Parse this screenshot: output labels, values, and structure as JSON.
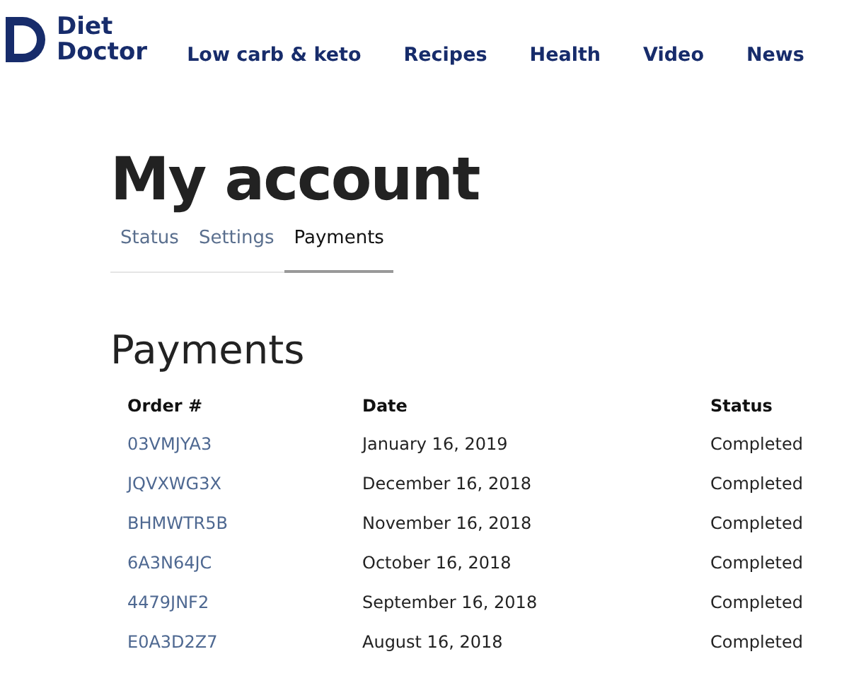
{
  "brand": {
    "line_1": "Diet",
    "line_2": "Doctor"
  },
  "nav": [
    "Low carb & keto",
    "Recipes",
    "Health",
    "Video",
    "News"
  ],
  "page_title": "My account",
  "tabs": [
    {
      "label": "Status",
      "selected": false
    },
    {
      "label": "Settings",
      "selected": false
    },
    {
      "label": "Payments",
      "selected": true
    }
  ],
  "section_title": "Payments",
  "table": {
    "columns": [
      "Order #",
      "Date",
      "Status"
    ],
    "rows": [
      [
        "03VMJYA3",
        "January 16, 2019",
        "Completed"
      ],
      [
        "JQVXWG3X",
        "December 16, 2018",
        "Completed"
      ],
      [
        "BHMWTR5B",
        "November 16, 2018",
        "Completed"
      ],
      [
        "6A3N64JC",
        "October 16, 2018",
        "Completed"
      ],
      [
        "4479JNF2",
        "September 16, 2018",
        "Completed"
      ],
      [
        "E0A3D2Z7",
        "August 16, 2018",
        "Completed"
      ]
    ]
  }
}
